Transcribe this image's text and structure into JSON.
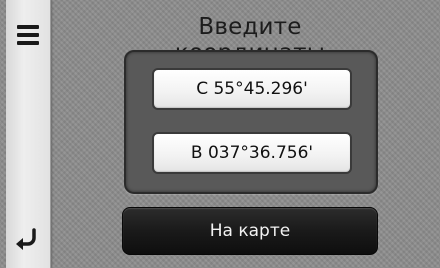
{
  "header": {
    "title": "Введите координаты"
  },
  "sidebar": {
    "menu_icon": "hamburger-menu-icon",
    "back_icon": "back-arrow-icon"
  },
  "coordinates": {
    "latitude": "С 55°45.296'",
    "longitude": "В 037°36.756'"
  },
  "actions": {
    "on_map_label": "На карте"
  }
}
